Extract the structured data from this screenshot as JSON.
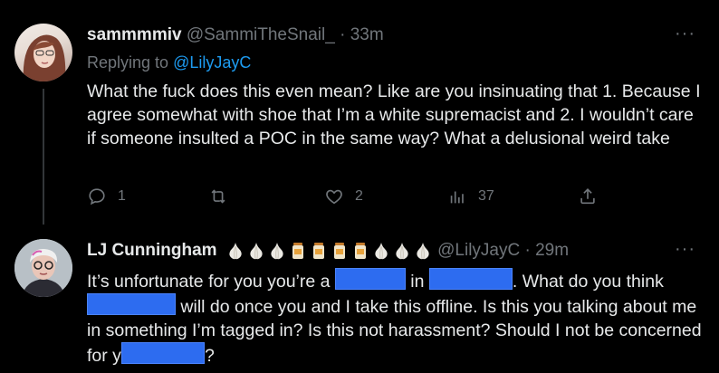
{
  "tweet1": {
    "display_name": "sammmmiv",
    "handle": "@SammiTheSnail_",
    "time": "· 33m",
    "replying_prefix": "Replying to",
    "replying_to": "@LilyJayC",
    "more": "···",
    "text": "What the fuck does this even mean? Like are you insinuating that 1. Because I agree somewhat with shoe that I’m a white supremacist and 2. I wouldn’t care if someone insulted a POC in the same way? What a delusional weird take",
    "actions": {
      "replies": "1",
      "retweets": "",
      "likes": "2",
      "views": "37"
    }
  },
  "tweet2": {
    "display_name": "LJ Cunningham",
    "handle": "@LilyJayC",
    "time": "· 29m",
    "more": "···",
    "emoji_sequence": [
      "garlic",
      "garlic",
      "garlic",
      "jar",
      "jar",
      "jar",
      "jar",
      "garlic",
      "garlic",
      "garlic"
    ],
    "text_parts": {
      "p1": "It’s unfortunate for you you’re a ",
      "p2": " in ",
      "p3": ". What do you think ",
      "p4": " will do once you and I take this offline. Is this you talking about me in something I’m tagged in? Is this not harassment? Should I not be concerned for y",
      "p5": "?"
    }
  },
  "colors": {
    "background": "#000000",
    "text": "#e7e9ea",
    "muted": "#71767b",
    "link": "#1d9bf0",
    "redaction": "#2d6cf0"
  }
}
